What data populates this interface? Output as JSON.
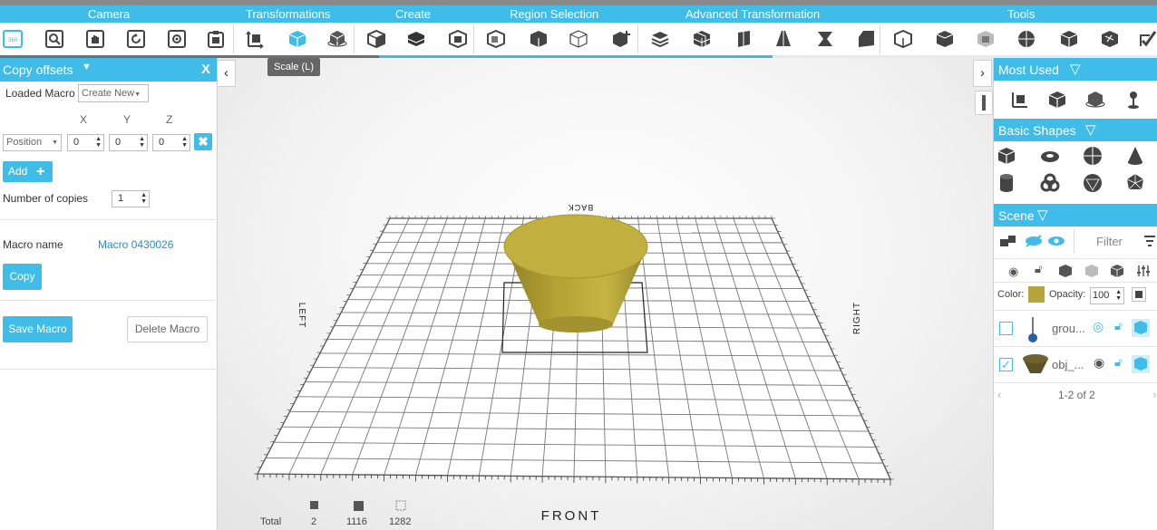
{
  "categories": [
    "Camera",
    "Transformations",
    "Create",
    "Region Selection",
    "Advanced Transformation",
    "Tools"
  ],
  "toolbar": {
    "tooltip": "Scale (L)",
    "camera_icons": [
      "view-360-icon",
      "zoom-icon",
      "pan-hand-icon",
      "rotate-icon",
      "settings-icon",
      "clipboard-icon"
    ],
    "transform_icons": [
      "move-axes-icon",
      "scale-cube-icon",
      "rotate-cube-icon"
    ],
    "create_icons": [
      "box-icon",
      "extrude-icon",
      "slice-icon"
    ],
    "region_icons": [
      "region-select-icon",
      "region-box-icon",
      "region-wire-icon",
      "region-add-icon"
    ],
    "advanced_icons": [
      "stack-icon",
      "grid-cube-icon",
      "bend-icon",
      "taper-icon",
      "twist-icon",
      "shear-icon"
    ],
    "tools_icons": [
      "measure-icon",
      "split-icon",
      "hollow-icon",
      "sphere-tool-icon",
      "cut-icon",
      "merge-icon",
      "check-icon"
    ]
  },
  "left_panel": {
    "title": "Copy offsets",
    "close": "X",
    "loaded_macro_label": "Loaded Macro",
    "loaded_macro_value": "Create New",
    "axes": [
      "X",
      "Y",
      "Z"
    ],
    "offset_mode": "Position",
    "offsets": [
      "0",
      "0",
      "0"
    ],
    "add_label": "Add",
    "copies_label": "Number of copies",
    "copies_value": "1",
    "macro_name_label": "Macro name",
    "macro_name_value": "Macro 0430026",
    "copy_label": "Copy",
    "save_label": "Save Macro",
    "delete_label": "Delete Macro"
  },
  "viewport": {
    "label_front": "FRONT",
    "label_back": "BACK",
    "label_left": "LEFT",
    "label_right": "RIGHT",
    "object_color": "#b6a53a",
    "stats": {
      "total_label": "Total",
      "objects": "2",
      "faces": "1116",
      "vertices": "1282"
    }
  },
  "right_panel": {
    "most_used_title": "Most Used",
    "basic_shapes_title": "Basic Shapes",
    "scene_title": "Scene",
    "filter_placeholder": "Filter",
    "color_label": "Color:",
    "color_value": "#b6a53a",
    "opacity_label": "Opacity:",
    "opacity_value": "100",
    "scene_items": [
      {
        "name": "grou...",
        "checked": false
      },
      {
        "name": "obj_...",
        "checked": true
      }
    ],
    "pagination": "1-2 of 2"
  },
  "colors": {
    "accent": "#3fbde8",
    "object": "#b6a53a"
  }
}
